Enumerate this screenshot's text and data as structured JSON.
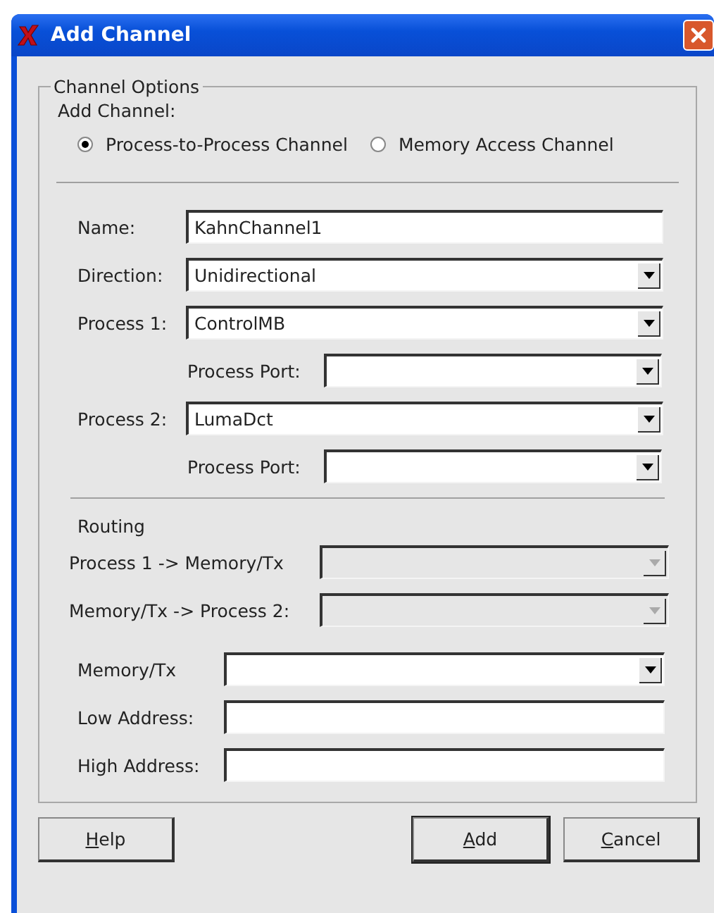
{
  "window": {
    "title": "Add Channel"
  },
  "group": {
    "title": "Channel Options"
  },
  "add_channel": {
    "label": "Add Channel:",
    "options": [
      {
        "label": "Process-to-Process Channel",
        "selected": true
      },
      {
        "label": "Memory Access Channel",
        "selected": false
      }
    ]
  },
  "fields": [
    {
      "label": "Name:",
      "kind": "text",
      "value": "KahnChannel1"
    },
    {
      "label": "Direction:",
      "kind": "combo",
      "value": "Unidirectional",
      "disabled": false
    },
    {
      "label": "Process 1:",
      "kind": "combo",
      "value": "ControlMB",
      "disabled": false,
      "port": {
        "label": "Process Port:",
        "kind": "combo",
        "disabled": false
      }
    },
    {
      "label": "Process 2:",
      "kind": "combo",
      "value": "LumaDct",
      "disabled": false,
      "port": {
        "label": "Process Port:",
        "kind": "combo",
        "disabled": false
      }
    }
  ],
  "routing": {
    "title": "Routing",
    "fields": [
      {
        "label": "Process 1 -> Memory/Tx",
        "kind": "combo",
        "disabled": true
      },
      {
        "label": "Memory/Tx -> Process 2:",
        "kind": "combo",
        "disabled": true
      }
    ]
  },
  "memory_fields": [
    {
      "label": "Memory/Tx",
      "kind": "combo",
      "disabled": false
    },
    {
      "label": "Low Address:",
      "kind": "text"
    },
    {
      "label": "High Address:",
      "kind": "text"
    }
  ],
  "buttons": [
    {
      "key": "H",
      "rest": "elp",
      "default": false
    },
    {
      "key": "A",
      "rest": "dd",
      "default": true
    },
    {
      "key": "C",
      "rest": "ancel",
      "default": false
    }
  ]
}
